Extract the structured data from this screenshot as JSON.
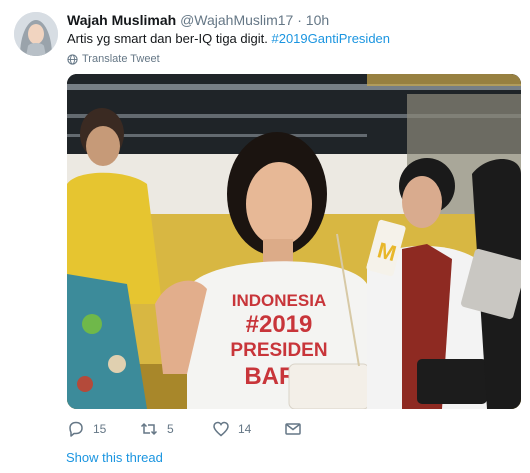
{
  "tweet": {
    "display_name": "Wajah Muslimah",
    "handle": "@WajahMuslim17",
    "separator": "·",
    "time": "10h",
    "text": "Artis yg smart dan ber-IQ tiga digit.",
    "hashtag": "#2019GantiPresiden",
    "translate_label": "Translate Tweet"
  },
  "photo": {
    "shirt_text": [
      "INDONESIA",
      "#2019",
      "PRESIDEN",
      "BARU"
    ],
    "cup_logo": "M"
  },
  "actions": {
    "replies": "15",
    "retweets": "5",
    "likes": "14"
  },
  "footer": {
    "show_thread": "Show this thread"
  },
  "colors": {
    "link": "#1b95e0",
    "muted": "#657786",
    "text": "#14171a"
  }
}
